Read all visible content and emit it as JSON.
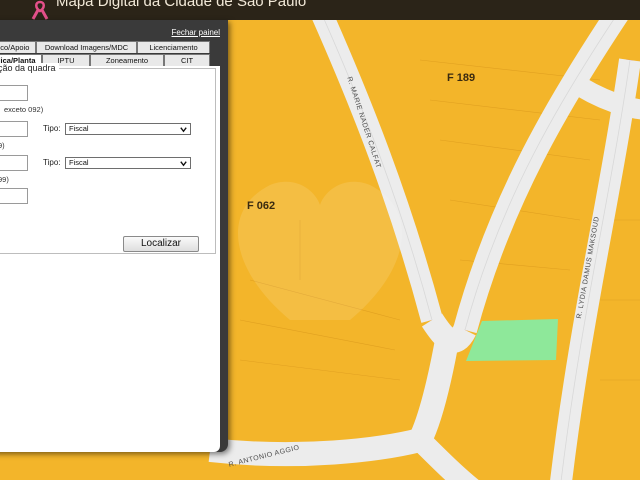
{
  "header": {
    "title": "Mapa Digital da Cidade de São Paulo"
  },
  "map": {
    "lot_labels": [
      "F 189",
      "F 062"
    ],
    "streets": [
      "R. MARIE NADER CALFAT",
      "R. LYDIA DAMUS MAKSOUD",
      "R. ANTONIO AGGIO"
    ],
    "colors": {
      "zone": "#f3b52a",
      "street": "#ececec",
      "highlight": "#8ee89a",
      "border": "#c9352a"
    }
  },
  "panel": {
    "close_label": "Fechar painel",
    "tabs_row1": [
      "ico/Apoio",
      "Download Imagens/MDC",
      "Licenciamento"
    ],
    "tabs_row2": [
      "lica/Planta",
      "IPTU",
      "Zoneamento",
      "CIT"
    ],
    "legend": "ção da quadra",
    "hint1": "exceto 092)",
    "hint2": "9)",
    "hint3": "99)",
    "tipo_label": "Tipo:",
    "select_value": "Fiscal",
    "button_label": "Localizar"
  }
}
